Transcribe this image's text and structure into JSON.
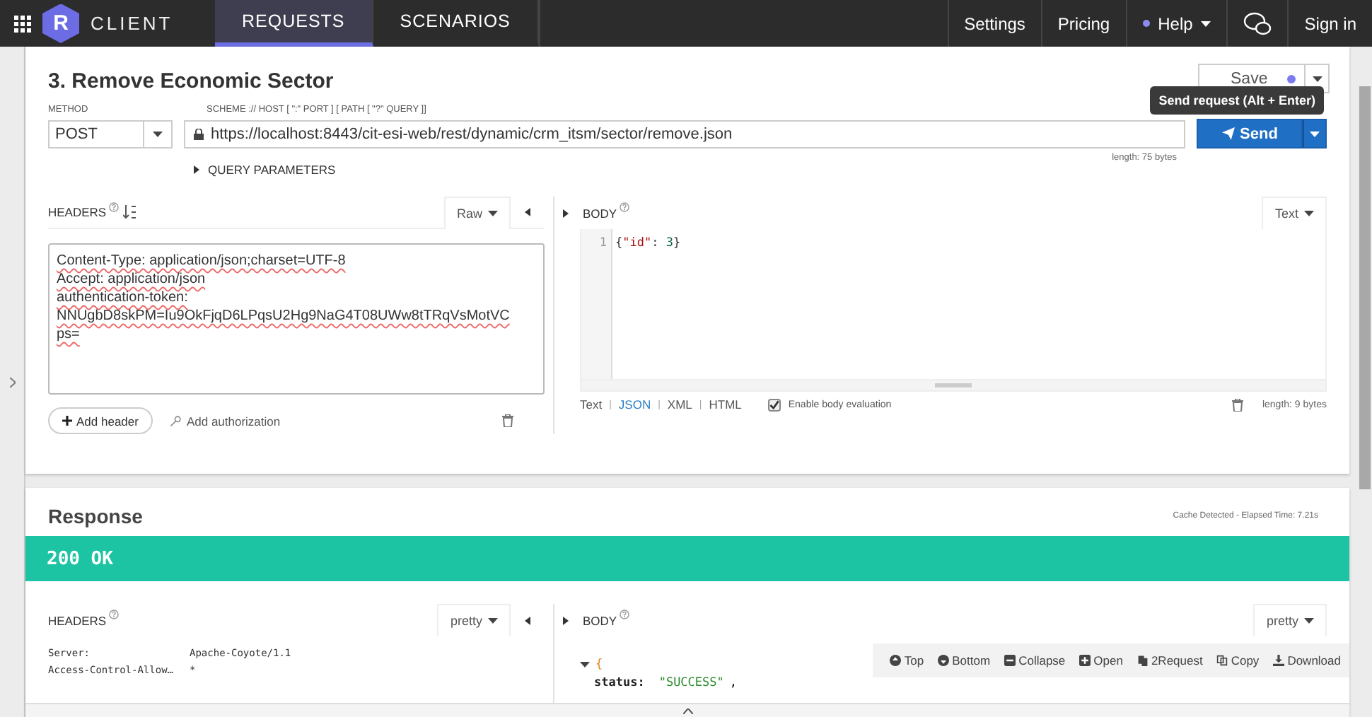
{
  "nav": {
    "brand": "CLIENT",
    "logo_letter": "R",
    "tabs": [
      {
        "label": "REQUESTS",
        "selected": true
      },
      {
        "label": "SCENARIOS",
        "selected": false
      }
    ],
    "links": [
      {
        "label": "Settings",
        "kind": "link"
      },
      {
        "label": "Pricing",
        "kind": "link"
      },
      {
        "label": "Help",
        "kind": "menu",
        "color": "#8c8cf0"
      },
      {
        "kind": "icon"
      },
      {
        "label": "Sign in",
        "kind": "link"
      }
    ]
  },
  "request": {
    "title": "3. Remove Economic Sector",
    "method_label": "METHOD",
    "method": "POST",
    "url_label": "SCHEME :// HOST [ \":\" PORT ] [ PATH [ \"?\" QUERY ]]",
    "url": "https://localhost:8443/cit-esi-web/rest/dynamic/crm_itsm/sector/remove.json",
    "url_length": "length: 75 bytes",
    "query_params": "QUERY PARAMETERS",
    "save": "Save",
    "unsaved": true,
    "send": "Send",
    "tooltip": "Send request (Alt + Enter)"
  },
  "headers": {
    "label": "HEADERS",
    "mode": "Raw",
    "lines": [
      "Content-Type: application/json;charset=UTF-8",
      "Accept: application/json",
      "authentication-token:",
      "NNUgbD8skPM=Iu9OkFjqD6LPqsU2Hg9NaG4T08UWw8tTRqVsMotVC",
      "ps="
    ],
    "add_header": "Add header",
    "add_authorization": "Add authorization"
  },
  "body": {
    "label": "BODY",
    "mode": "Text",
    "line_number": "1",
    "tokens": [
      {
        "kind": "punct",
        "text": "{"
      },
      {
        "kind": "key",
        "text": "\"id\""
      },
      {
        "kind": "punct",
        "text": ": "
      },
      {
        "kind": "number",
        "text": "3"
      },
      {
        "kind": "punct",
        "text": "}"
      }
    ],
    "formats": [
      {
        "label": "Text",
        "selected": false
      },
      {
        "label": "JSON",
        "selected": true
      },
      {
        "label": "XML",
        "selected": false
      },
      {
        "label": "HTML",
        "selected": false
      }
    ],
    "format_separator": "|",
    "evaluation": {
      "label": "Enable body evaluation",
      "checked": true
    },
    "length": "length: 9 bytes"
  },
  "response": {
    "title": "Response",
    "timing": "Cache Detected - Elapsed Time: 7.21s",
    "status": "200 OK",
    "headers_label": "HEADERS",
    "headers_mode": "pretty",
    "header_rows": [
      {
        "name": "Server:",
        "value": "Apache-Coyote/1.1"
      },
      {
        "name": "Access-Control-Allow…",
        "value": "*"
      }
    ],
    "body_label": "BODY",
    "body_mode": "pretty",
    "toolbar": [
      {
        "label": "Top",
        "kind": "up"
      },
      {
        "label": "Bottom",
        "kind": "down"
      },
      {
        "label": "Collapse",
        "kind": "minus"
      },
      {
        "label": "Open",
        "kind": "plus"
      },
      {
        "label": "2Request",
        "kind": "file"
      },
      {
        "label": "Copy",
        "kind": "copy"
      },
      {
        "label": "Download",
        "kind": "download"
      }
    ],
    "open_brace": "{",
    "field_key": "status:",
    "field_value": "\"SUCCESS\"",
    "field_comma": ","
  }
}
